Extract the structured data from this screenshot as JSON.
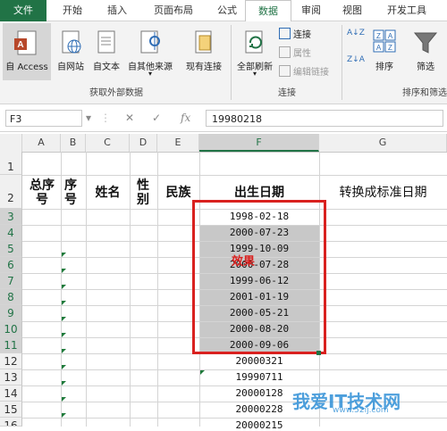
{
  "ribbon_tabs": [
    "文件",
    "开始",
    "插入",
    "页面布局",
    "公式",
    "数据",
    "审阅",
    "视图",
    "开发工具"
  ],
  "ribbon": {
    "buttons": {
      "access": "自 Access",
      "web": "自网站",
      "text": "自文本",
      "other": "自其他来源",
      "existing": "现有连接",
      "refresh_all": "全部刷新",
      "sort": "排序",
      "filter": "筛选"
    },
    "connections": {
      "connect": "连接",
      "properties": "属性",
      "edit_links": "编辑链接"
    },
    "groups": {
      "external": "获取外部数据",
      "connections": "连接",
      "sort_filter": "排序和筛选"
    },
    "sort_az": "A↓Z",
    "sort_za": "Z↓A"
  },
  "formula_bar": {
    "name_box": "F3",
    "fx": "fx",
    "value": "19980218"
  },
  "columns": [
    "A",
    "B",
    "C",
    "D",
    "E",
    "F",
    "G"
  ],
  "rows": [
    "1",
    "2",
    "3",
    "4",
    "5",
    "6",
    "7",
    "8",
    "9",
    "10",
    "11",
    "12",
    "13",
    "14",
    "15",
    "16"
  ],
  "headers": {
    "a": "总序号",
    "b": "序号",
    "c": "姓名",
    "d": "性别",
    "e": "民族",
    "f": "出生日期",
    "g": "转换成标准日期"
  },
  "f_values": [
    "1998-02-18",
    "2000-07-23",
    "1999-10-09",
    "2000-07-28",
    "1999-06-12",
    "2001-01-19",
    "2000-05-21",
    "2000-08-20",
    "2000-09-06",
    "20000321",
    "19990711",
    "20000128",
    "20000228",
    "20000215"
  ],
  "annotation": "效果",
  "watermark": "我爱IT技术网",
  "watermark_url": "www.52ij.com",
  "colors": {
    "accent": "#217346",
    "highlight_border": "#d9211f",
    "converted_fill": "#c8c8c8"
  }
}
